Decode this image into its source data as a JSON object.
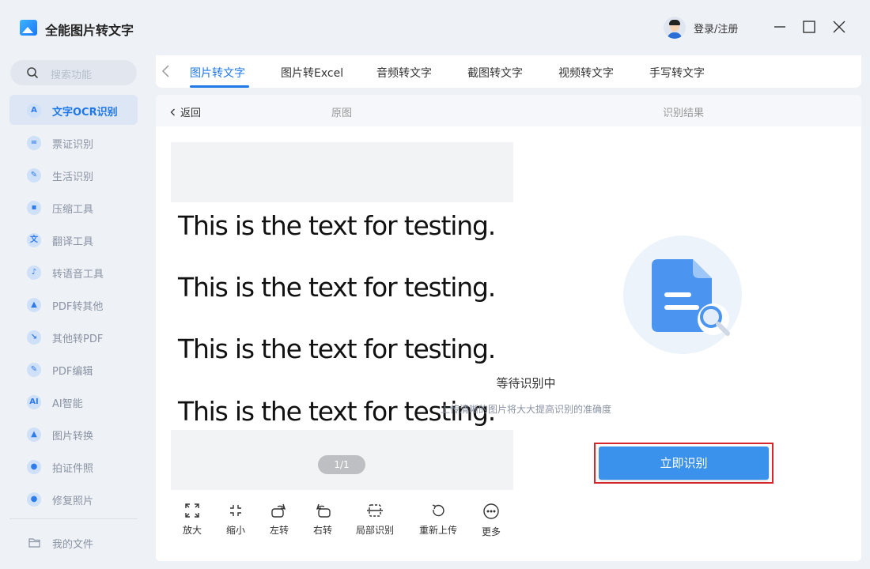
{
  "app": {
    "title": "全能图片转文字",
    "login_label": "登录/注册"
  },
  "search": {
    "placeholder": "搜索功能"
  },
  "sidebar": {
    "items": [
      {
        "label": "文字OCR识别",
        "icon": "ocr-icon",
        "glyph": "A",
        "active": true
      },
      {
        "label": "票证识别",
        "icon": "ticket-icon",
        "glyph": "="
      },
      {
        "label": "生活识别",
        "icon": "life-icon",
        "glyph": "✎"
      },
      {
        "label": "压缩工具",
        "icon": "compress-icon",
        "glyph": "▪"
      },
      {
        "label": "翻译工具",
        "icon": "translate-icon",
        "glyph": "文"
      },
      {
        "label": "转语音工具",
        "icon": "voice-icon",
        "glyph": "♪"
      },
      {
        "label": "PDF转其他",
        "icon": "pdf-convert-icon",
        "glyph": "▲"
      },
      {
        "label": "其他转PDF",
        "icon": "to-pdf-icon",
        "glyph": "↘"
      },
      {
        "label": "PDF编辑",
        "icon": "pdf-edit-icon",
        "glyph": "✎"
      },
      {
        "label": "AI智能",
        "icon": "ai-icon",
        "glyph": "AI"
      },
      {
        "label": "图片转换",
        "icon": "image-convert-icon",
        "glyph": "▲"
      },
      {
        "label": "拍证件照",
        "icon": "id-photo-icon",
        "glyph": "●"
      },
      {
        "label": "修复照片",
        "icon": "repair-photo-icon",
        "glyph": "●"
      }
    ],
    "my_files": "我的文件"
  },
  "tabs": [
    {
      "label": "图片转文字",
      "active": true
    },
    {
      "label": "图片转Excel"
    },
    {
      "label": "音频转文字"
    },
    {
      "label": "截图转文字"
    },
    {
      "label": "视频转文字"
    },
    {
      "label": "手写转文字"
    }
  ],
  "panel": {
    "back_label": "返回",
    "original_label": "原图",
    "result_label": "识别结果",
    "preview_lines": [
      "This is the text for testing.",
      "This is the text for testing.",
      "This is the text for testing.",
      "This is the text for testing."
    ],
    "page_indicator": "1/1",
    "tools": [
      {
        "label": "放大",
        "icon": "zoom-in-icon"
      },
      {
        "label": "缩小",
        "icon": "zoom-out-icon"
      },
      {
        "label": "左转",
        "icon": "rotate-left-icon"
      },
      {
        "label": "右转",
        "icon": "rotate-right-icon"
      },
      {
        "label": "局部识别",
        "icon": "partial-recognize-icon"
      },
      {
        "label": "重新上传",
        "icon": "reupload-icon"
      },
      {
        "label": "更多",
        "icon": "more-icon"
      }
    ],
    "status_title": "等待识别中",
    "status_subtitle": "上传清晰的图片将大大提高识别的准确度",
    "recognize_button": "立即识别"
  },
  "colors": {
    "accent": "#1e78e8",
    "button": "#3b92ec",
    "highlight_border": "#d9262c"
  }
}
